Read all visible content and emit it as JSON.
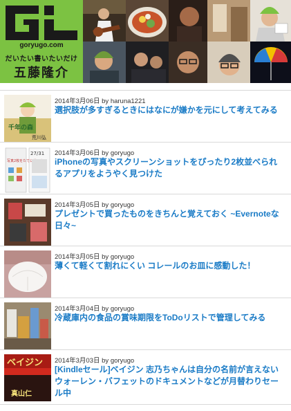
{
  "header": {
    "logo_domain": "goryugo.com",
    "logo_tagline": "だいたい書いたいだけ",
    "logo_name": "五藤隆介"
  },
  "posts": [
    {
      "date": "2014年3月06日",
      "by": "by",
      "author": "haruna1221",
      "title": "選択肢が多すぎるときにはなにが嫌かを元にして考えてみる"
    },
    {
      "date": "2014年3月06日",
      "by": "by",
      "author": "goryugo",
      "title": "iPhoneの写真やスクリーンショットをぴったり2枚並べられるアプリをようやく見つけた"
    },
    {
      "date": "2014年3月05日",
      "by": "by",
      "author": "goryugo",
      "title": "プレゼントで買ったものをきちんと覚えておく ~Evernoteな日々~"
    },
    {
      "date": "2014年3月05日",
      "by": "by",
      "author": "goryugo",
      "title": "薄くて軽くて割れにくい コレールのお皿に感動した！"
    },
    {
      "date": "2014年3月04日",
      "by": "by",
      "author": "goryugo",
      "title": "冷蔵庫内の食品の賞味期限をToDoリストで管理してみる"
    },
    {
      "date": "2014年3月03日",
      "by": "by",
      "author": "goryugo",
      "title": "[Kindleセール]ベイジン 志乃ちゃんは自分の名前が言えない ウォーレン・バフェットのドキュメントなどが月替わりセール中"
    }
  ],
  "thumbs": [
    {
      "book_title": "千年の森",
      "book_author": "荒川弘"
    },
    {
      "date_label": "27/31",
      "caption": "写真2枚をたてに並べたい"
    },
    {},
    {},
    {},
    {
      "book_title": "ベイジン",
      "book_author": "真山仁"
    }
  ]
}
